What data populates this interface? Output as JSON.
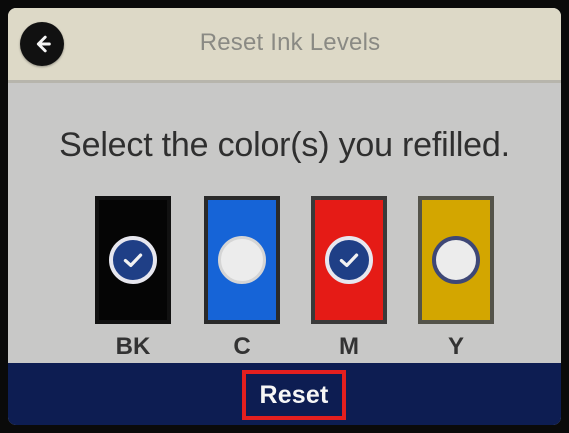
{
  "header": {
    "title": "Reset Ink Levels"
  },
  "main": {
    "prompt": "Select the color(s) you refilled."
  },
  "inks": [
    {
      "label": "BK",
      "selected": true,
      "color": "#050505"
    },
    {
      "label": "C",
      "selected": false,
      "color": "#1664d7"
    },
    {
      "label": "M",
      "selected": true,
      "color": "#e51b16"
    },
    {
      "label": "Y",
      "selected": false,
      "color": "#d3a600"
    }
  ],
  "footer": {
    "reset_label": "Reset"
  },
  "icons": {
    "back": "back-arrow-icon",
    "checked": "check-icon",
    "unchecked": "empty-circle-icon"
  },
  "colors": {
    "screen_background": "#c8c8c7",
    "header_background": "#ddd9c7",
    "footer_background": "#0d1d52",
    "highlight": "#e31f1f"
  }
}
